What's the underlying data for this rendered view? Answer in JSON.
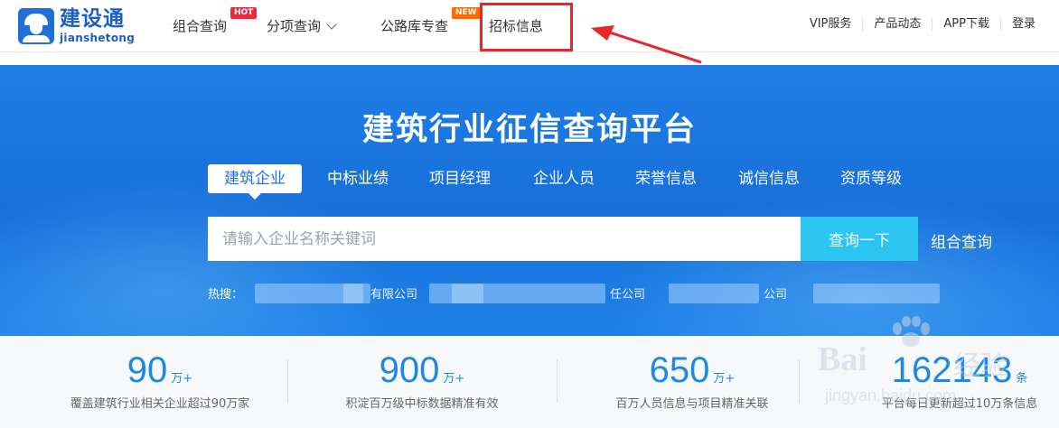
{
  "logo": {
    "cn": "建设通",
    "en": "jianshetong"
  },
  "nav": {
    "combo": "组合查询",
    "hot_tag": "HOT",
    "sub": "分项查询",
    "road": "公路库专查",
    "new_tag": "NEW",
    "bid": "招标信息"
  },
  "right_nav": [
    "VIP服务",
    "产品动态",
    "APP下载",
    "登录"
  ],
  "hero": {
    "title": "建筑行业征信查询平台",
    "tabs": [
      "建筑企业",
      "中标业绩",
      "项目经理",
      "企业人员",
      "荣誉信息",
      "诚信信息",
      "资质等级"
    ],
    "search_placeholder": "请输入企业名称关键词",
    "search_button": "查询一下",
    "combo_link": "组合查询",
    "hot_label": "热搜：",
    "hot_items": [
      "有限公司",
      "任公司",
      "公司"
    ]
  },
  "stats": [
    {
      "num": "90",
      "unit": "万+",
      "desc": "覆盖建筑行业相关企业超过90万家"
    },
    {
      "num": "900",
      "unit": "万+",
      "desc": "积淀百万级中标数据精准有效"
    },
    {
      "num": "650",
      "unit": "万+",
      "desc": "百万人员信息与项目精准关联"
    },
    {
      "num": "162143",
      "unit": "条",
      "desc": "平台每日更新超过10万条信息"
    }
  ],
  "watermark": {
    "brand": "Bai",
    "brand2": "经验",
    "url": "jingyan.baidu.com"
  },
  "colors": {
    "brand": "#1a5fc7",
    "hero": "#176fda",
    "accent": "#2bc5f1",
    "stat": "#1e88e5",
    "highlight": "#e8262a"
  }
}
